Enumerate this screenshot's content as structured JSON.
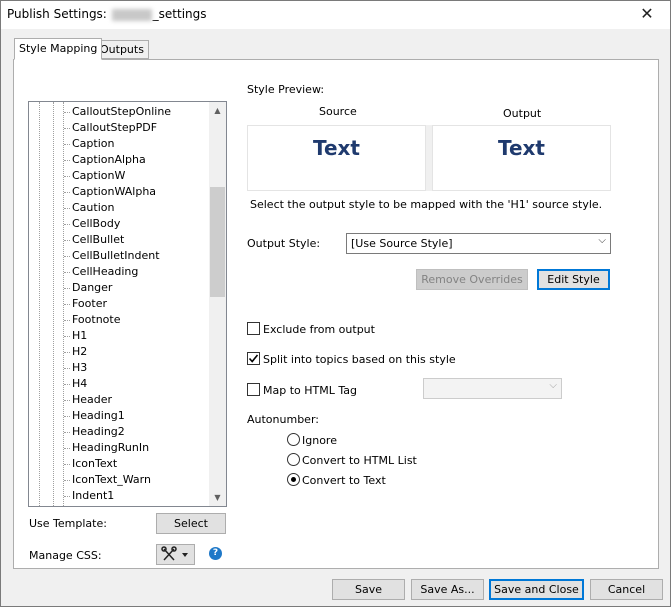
{
  "window": {
    "title_prefix": "Publish Settings: ",
    "title_suffix": "_settings",
    "close_glyph": "✕"
  },
  "tabs": [
    {
      "label": "Style Mapping",
      "active": true
    },
    {
      "label": "Outputs",
      "active": false
    }
  ],
  "style_list": {
    "items": [
      "CalloutStepOnline",
      "CalloutStepPDF",
      "Caption",
      "CaptionAlpha",
      "CaptionW",
      "CaptionWAlpha",
      "Caution",
      "CellBody",
      "CellBullet",
      "CellBulletIndent",
      "CellHeading",
      "Danger",
      "Footer",
      "Footnote",
      "H1",
      "H2",
      "H3",
      "H4",
      "Header",
      "Heading1",
      "Heading2",
      "HeadingRunIn",
      "IconText",
      "IconText_Warn",
      "Indent1"
    ],
    "selected": "H1"
  },
  "preview": {
    "heading": "Style Preview:",
    "source_label": "Source",
    "output_label": "Output",
    "source_text": "Text",
    "output_text": "Text",
    "text_color": "#1f3a6e"
  },
  "instruction": "Select the output style to be mapped with the 'H1' source style.",
  "output_style": {
    "label": "Output Style:",
    "value": "[Use Source Style]"
  },
  "buttons": {
    "remove_overrides": "Remove Overrides",
    "edit_style": "Edit Style",
    "select": "Select",
    "save": "Save",
    "save_as": "Save As...",
    "save_close": "Save and Close",
    "cancel": "Cancel"
  },
  "options": {
    "exclude": {
      "label": "Exclude from output",
      "checked": false
    },
    "split": {
      "label": "Split into topics based on this style",
      "checked": true
    },
    "map_html": {
      "label": "Map to HTML Tag",
      "checked": false,
      "value": ""
    }
  },
  "autonumber": {
    "label": "Autonumber:",
    "options": [
      {
        "label": "Ignore",
        "selected": false
      },
      {
        "label": "Convert to HTML List",
        "selected": false
      },
      {
        "label": "Convert to Text",
        "selected": true
      }
    ]
  },
  "template": {
    "label": "Use Template:"
  },
  "css": {
    "label": "Manage CSS:",
    "help": "?"
  }
}
